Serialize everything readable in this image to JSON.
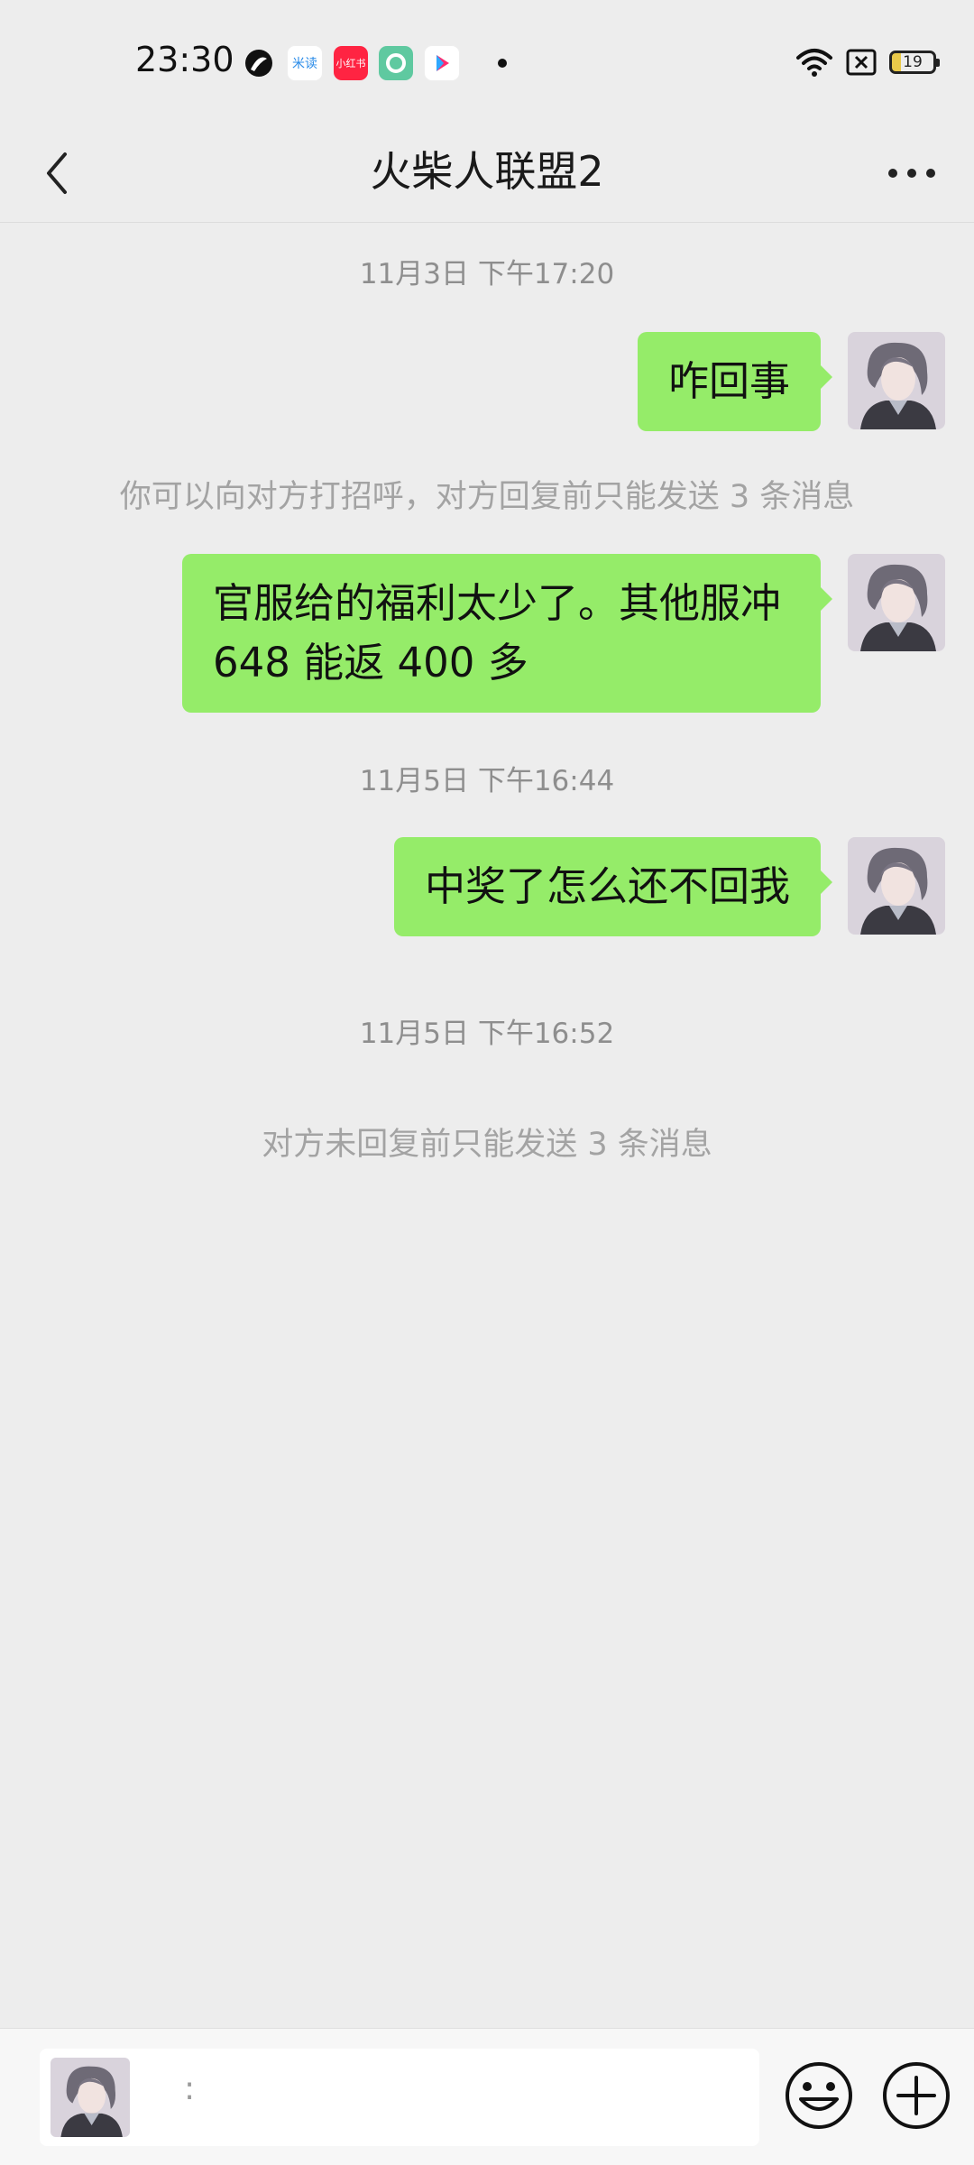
{
  "status_bar": {
    "time": "23:30",
    "app_icons": [
      "zhihu-like-icon",
      "midu-icon",
      "xiaohongshu-icon",
      "green-app-icon",
      "youku-icon"
    ],
    "battery": "19",
    "app_label_midu": "米读",
    "app_label_xhs": "小红书"
  },
  "header": {
    "title": "火柴人联盟2"
  },
  "messages": [
    {
      "type": "timestamp",
      "text": "11月3日 下午17:20"
    },
    {
      "type": "sent",
      "text": "咋回事"
    },
    {
      "type": "system",
      "text": "你可以向对方打招呼，对方回复前只能发送 3 条消息"
    },
    {
      "type": "sent",
      "lines": [
        "官服给的福利太少了。其他服冲",
        "648 能返 400 多"
      ]
    },
    {
      "type": "timestamp",
      "text": "11月5日 下午16:44"
    },
    {
      "type": "sent",
      "text": "中奖了怎么还不回我"
    },
    {
      "type": "timestamp",
      "text": "11月5日 下午16:52"
    },
    {
      "type": "system",
      "text": "对方未回复前只能发送 3 条消息"
    }
  ],
  "input_bar": {
    "input_text": ":"
  },
  "colors": {
    "bubble": "#95ec69",
    "background": "#ededed"
  }
}
